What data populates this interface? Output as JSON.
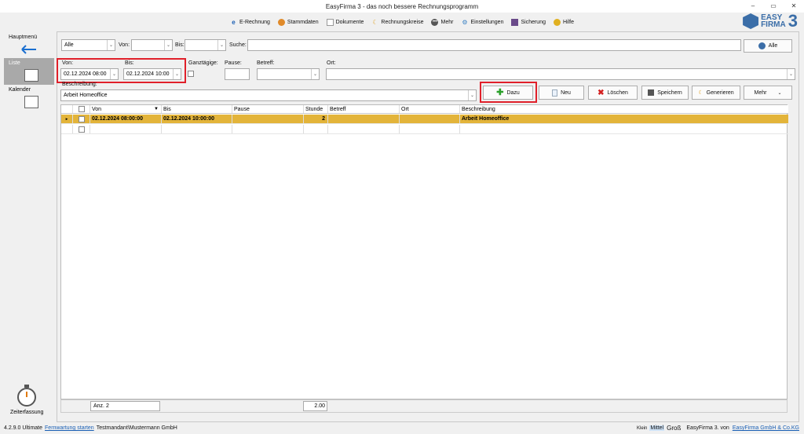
{
  "window": {
    "title": "EasyFirma 3 - das noch bessere Rechnungsprogramm",
    "controls": [
      "–",
      "▭",
      "✕"
    ]
  },
  "topmenu": [
    {
      "label": "E-Rechnung",
      "icon": "e-icon"
    },
    {
      "label": "Stammdaten",
      "icon": "people-icon"
    },
    {
      "label": "Dokumente",
      "icon": "document-icon"
    },
    {
      "label": "Rechnungskreise",
      "icon": "moon-icon"
    },
    {
      "label": "Mehr",
      "icon": "more-icon"
    },
    {
      "label": "Einstellungen",
      "icon": "gear-icon"
    },
    {
      "label": "Sicherung",
      "icon": "backup-icon"
    },
    {
      "label": "Hilfe",
      "icon": "help-icon"
    }
  ],
  "logo": {
    "line1": "EASY",
    "line2": "FIRMA",
    "number": "3"
  },
  "sidebar": {
    "hauptmenu": "Hauptmenü",
    "liste": "Liste",
    "kalender": "Kalender",
    "zeiterfassung": "Zeiterfassung"
  },
  "filters": {
    "status_value": "Alle",
    "von_label": "Von:",
    "bis_label": "Bis:",
    "suche_label": "Suche:",
    "alle_button": "Alle"
  },
  "entry": {
    "von_label": "Von:",
    "von_value": "02.12.2024 08:00",
    "bis_label": "Bis:",
    "bis_value": "02.12.2024 10:00",
    "ganztaegig_label": "Ganztägige:",
    "pause_label": "Pause:",
    "betreff_label": "Betreff:",
    "ort_label": "Ort:",
    "beschreibung_label": "Beschreibung:",
    "beschreibung_value": "Arbeit Homeoffice"
  },
  "actions": {
    "dazu": "Dazu",
    "neu": "Neu",
    "loeschen": "Löschen",
    "speichern": "Speichern",
    "generieren": "Generieren",
    "mehr": "Mehr"
  },
  "table": {
    "columns": [
      "Von",
      "Bis",
      "Pause",
      "Stunde",
      "Betreff",
      "Ort",
      "Beschreibung"
    ],
    "rows": [
      {
        "von": "02.12.2024 08:00:00",
        "bis": "02.12.2024 10:00:00",
        "pause": "",
        "stunde": "2",
        "betreff": "",
        "ort": "",
        "beschreibung": "Arbeit Homeoffice"
      }
    ],
    "footer_count": "Anz. 2",
    "footer_sum": "2.00"
  },
  "status": {
    "version": "4.2.9.0 Ultimate",
    "fernwartung": "Fernwartung starten",
    "mandant": "Testmandant\\Mustermann GmbH",
    "size_small": "Klein",
    "size_mid": "Mittel",
    "size_large": "Groß",
    "product": "EasyFirma 3. von",
    "company": "EasyFirma GmbH & Co.KG"
  },
  "colors": {
    "highlight_row": "#e3b43a",
    "red_box": "#e0202a",
    "accent": "#3b6ea8"
  }
}
